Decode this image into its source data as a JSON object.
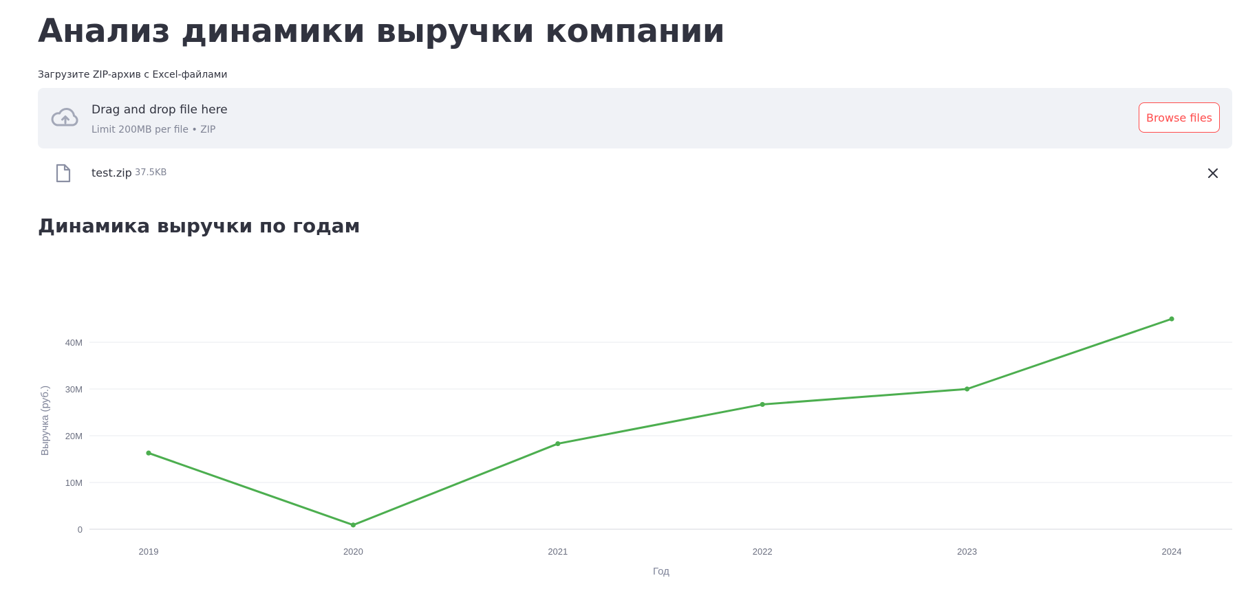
{
  "page": {
    "title": "Анализ динамики выручки компании",
    "subheader": "Динамика выручки по годам"
  },
  "uploader": {
    "label": "Загрузите ZIP-архив с Excel-файлами",
    "drop_text": "Drag and drop file here",
    "limit_text": "Limit 200MB per file • ZIP",
    "browse_label": "Browse files",
    "icon": "cloud-upload-icon",
    "accent_color": "#ff4b4b"
  },
  "file": {
    "name": "test.zip",
    "size": "37.5KB",
    "icon": "file-icon",
    "close_icon": "close-icon"
  },
  "chart_data": {
    "type": "line",
    "title": "",
    "xlabel": "Год",
    "ylabel": "Выручка (руб.)",
    "x": [
      "2019",
      "2020",
      "2021",
      "2022",
      "2023",
      "2024"
    ],
    "series": [
      {
        "color": "#4cae4f",
        "values": [
          16300000,
          900000,
          18300000,
          26700000,
          30000000,
          45000000
        ]
      }
    ],
    "y_ticks": [
      0,
      10000000,
      20000000,
      30000000,
      40000000
    ],
    "y_tick_labels": [
      "0",
      "10M",
      "20M",
      "30M",
      "40M"
    ],
    "ylim": [
      0,
      50000000
    ],
    "grid": true,
    "legend": "none"
  }
}
